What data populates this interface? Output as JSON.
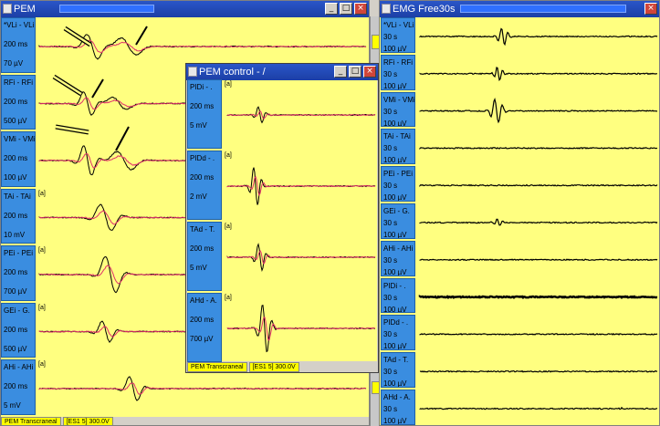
{
  "windows": {
    "pem": {
      "title": "PEM",
      "status": [
        "PEM Transcraneal",
        "[ES1 5] 300.0V"
      ],
      "channels": [
        {
          "name": "*VLi - VLi",
          "time": "200 ms",
          "gain": "70 µV",
          "bracket": ""
        },
        {
          "name": "RFi - RFi",
          "time": "200 ms",
          "gain": "500 µV",
          "bracket": ""
        },
        {
          "name": "VMi - VMi",
          "time": "200 ms",
          "gain": "100 µV",
          "bracket": ""
        },
        {
          "name": "TAi - TAi",
          "time": "200 ms",
          "gain": "10 mV",
          "bracket": "[a]"
        },
        {
          "name": "PEi - PEi",
          "time": "200 ms",
          "gain": "700 µV",
          "bracket": "[a]"
        },
        {
          "name": "GEi - G.",
          "time": "200 ms",
          "gain": "500 µV",
          "bracket": "[a]"
        },
        {
          "name": "AHi - AHi",
          "time": "200 ms",
          "gain": "5 mV",
          "bracket": "[a]"
        }
      ]
    },
    "pem_control": {
      "title": "PEM control - /",
      "status": [
        "PEM Transcraneal",
        "[ES1 5] 300.0V"
      ],
      "channels": [
        {
          "name": "PIDi - .",
          "time": "200 ms",
          "gain": "5 mV",
          "bracket": "[a]"
        },
        {
          "name": "PIDd - .",
          "time": "200 ms",
          "gain": "2 mV",
          "bracket": "[a]"
        },
        {
          "name": "TAd - T.",
          "time": "200 ms",
          "gain": "5 mV",
          "bracket": "[a]"
        },
        {
          "name": "AHd - A.",
          "time": "200 ms",
          "gain": "700 µV",
          "bracket": "[a]"
        }
      ]
    },
    "emg": {
      "title": "EMG Free30s",
      "channels": [
        {
          "name": "*VLi - VLi",
          "time": "30 s",
          "gain": "100 µV"
        },
        {
          "name": "RFi - RFi",
          "time": "30 s",
          "gain": "100 µV"
        },
        {
          "name": "VMi - VMi",
          "time": "30 s",
          "gain": "100 µV"
        },
        {
          "name": "TAi - TAi",
          "time": "30 s",
          "gain": "100 µV"
        },
        {
          "name": "PEi - PEi",
          "time": "30 s",
          "gain": "100 µV"
        },
        {
          "name": "GEi - G.",
          "time": "30 s",
          "gain": "100 µV"
        },
        {
          "name": "AHi - AHi",
          "time": "30 s",
          "gain": "100 µV"
        },
        {
          "name": "PIDi - .",
          "time": "30 s",
          "gain": "100 µV"
        },
        {
          "name": "PIDd - .",
          "time": "30 s",
          "gain": "100 µV"
        },
        {
          "name": "TAd - T.",
          "time": "30 s",
          "gain": "100 µV"
        },
        {
          "name": "AHd - A.",
          "time": "30 s",
          "gain": "100 µV"
        }
      ]
    }
  },
  "window_buttons": {
    "minimize": "_",
    "maximize": "□",
    "close": "×"
  },
  "colors": {
    "trace_primary": "#000000",
    "trace_control": "#e0306a",
    "panel_bg": "#ffff80",
    "label_bg": "#3a8de0",
    "titlebar": "#1c3fa6"
  }
}
